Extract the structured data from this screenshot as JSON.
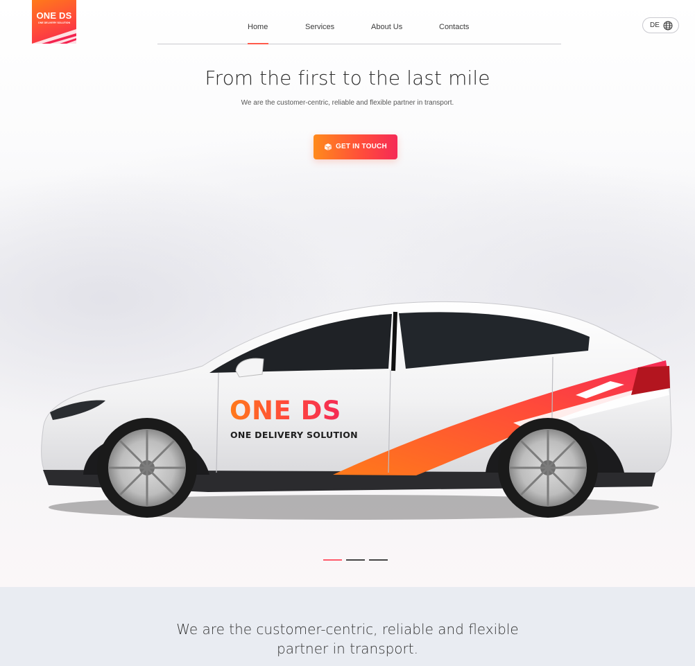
{
  "brand": {
    "logo_title": "ONE DS",
    "logo_subtitle": "ONE DELIVERY SOLUTION",
    "accent_orange": "#ff7a1a",
    "accent_pink": "#f42a55"
  },
  "nav": {
    "items": [
      {
        "label": "Home",
        "active": true
      },
      {
        "label": "Services",
        "active": false
      },
      {
        "label": "About Us",
        "active": false
      },
      {
        "label": "Contacts",
        "active": false
      }
    ]
  },
  "language": {
    "label": "DE",
    "icon": "globe-icon"
  },
  "hero": {
    "headline": "From the first to the last mile",
    "subline": "We are the customer-centric, reliable and flexible partner in transport.",
    "cta_label": "GET IN TOUCH",
    "cta_icon": "box-icon",
    "car_brand": "ONE DS",
    "car_tagline": "ONE DELIVERY SOLUTION"
  },
  "carousel": {
    "slide_count": 3,
    "active_index": 0
  },
  "about": {
    "text": "We are the customer-centric, reliable and flexible partner in transport."
  }
}
